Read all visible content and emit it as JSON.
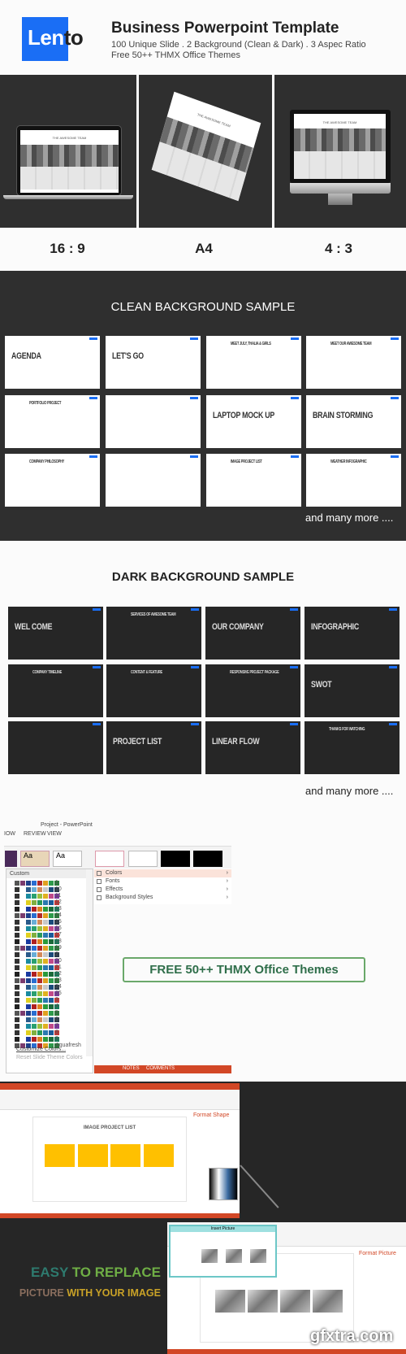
{
  "header": {
    "logo_text_a": "Len",
    "logo_text_b": "to",
    "title": "Business Powerpoint Template",
    "subtitle_1": "100 Unique Slide . 2 Background (Clean & Dark) . 3 Aspec Ratio",
    "subtitle_2": "Free 50++ THMX Office Themes"
  },
  "devices": [
    {
      "label": "16 : 9",
      "device": "laptop",
      "slide_title": "THE AWESOME TEAM"
    },
    {
      "label": "A4",
      "device": "paper",
      "slide_title": "THE AWESOME TEAM"
    },
    {
      "label": "4 : 3",
      "device": "monitor",
      "slide_title": "THE AWESOME TEAM"
    }
  ],
  "clean": {
    "title": "CLEAN BACKGROUND SAMPLE",
    "slides": [
      {
        "title": "AGENDA"
      },
      {
        "title": "LET'S GO"
      },
      {
        "title": "MEET JULY, THALIA & GIRLS"
      },
      {
        "title": "MEET OUR AWESOME TEAM"
      },
      {
        "title": "PORTFOLIO PROJECT"
      },
      {
        "title": ""
      },
      {
        "title": "LAPTOP MOCK UP"
      },
      {
        "title": "BRAIN STORMING"
      },
      {
        "title": "COMPANY PHILOSOPHY"
      },
      {
        "title": ""
      },
      {
        "title": "IMAGE PROJECT LIST"
      },
      {
        "title": "WEATHER INFOGRAPHIC"
      }
    ],
    "more": "and many more ...."
  },
  "dark": {
    "title": "DARK BACKGROUND SAMPLE",
    "slides": [
      {
        "title": "WEL COME"
      },
      {
        "title": "SERVICES OF AWESOME TEAM"
      },
      {
        "title": "OUR COMPANY"
      },
      {
        "title": "INFOGRAPHIC"
      },
      {
        "title": "COMPANY TIMELINE"
      },
      {
        "title": "CONTENT & FEATURE"
      },
      {
        "title": "RESPONSIVE PROJECT PACKAGE"
      },
      {
        "title": "SWOT"
      },
      {
        "title": ""
      },
      {
        "title": "PROJECT LIST"
      },
      {
        "title": "LINEAR FLOW"
      },
      {
        "title": "THANKS FOR WATCHING"
      }
    ],
    "more": "and many more ...."
  },
  "powerpoint": {
    "window_title": "Project - PowerPoint",
    "tabs": [
      "IOW",
      "REVIEW",
      "VIEW"
    ],
    "list_header": "Custom",
    "themes": [
      "1",
      "10",
      "11",
      "12",
      "13",
      "14",
      "15",
      "16",
      "17",
      "18",
      "19",
      "2",
      "20",
      "21",
      "22",
      "23",
      "24",
      "25",
      "3",
      "4",
      "5",
      "6",
      "7",
      "8",
      "9",
      "Aquafresh"
    ],
    "palettes": [
      [
        "#555",
        "#7a3b6e",
        "#1f3f8a",
        "#2a6dd0",
        "#b22a2a",
        "#e0a020",
        "#2d9a4a",
        "#2a7a3a"
      ],
      [
        "#333",
        "#fff",
        "#2a5a8a",
        "#6aaed6",
        "#d48a5a",
        "#c8c8c8",
        "#1a4a7a",
        "#2a3a4a"
      ],
      [
        "#333",
        "#fff",
        "#1a8aa0",
        "#2aa070",
        "#9ac040",
        "#e0b020",
        "#c04a8a",
        "#7a3a9a"
      ],
      [
        "#333",
        "#fff",
        "#e0d020",
        "#80b040",
        "#2a9a5a",
        "#2a7ab0",
        "#1a5a9a",
        "#c03a3a"
      ],
      [
        "#222",
        "#fff",
        "#1a3aa0",
        "#b02020",
        "#e08020",
        "#2a9a3a",
        "#1a6a3a",
        "#1a7a5a"
      ]
    ],
    "menu": [
      {
        "label": "Colors",
        "icon": "colors-icon"
      },
      {
        "label": "Fonts",
        "icon": "fonts-icon"
      },
      {
        "label": "Effects",
        "icon": "effects-icon"
      },
      {
        "label": "Background Styles",
        "icon": "background-styles-icon"
      }
    ],
    "footer_links": [
      "Customize Colors...",
      "Reset Slide Theme Colors"
    ],
    "status": {
      "notes": "NOTES",
      "comments": "COMMENTS"
    },
    "promo": "FREE 50++ THMX Office Themes"
  },
  "replace": {
    "slide_title": "IMAGE PROJECT LIST",
    "panel_1": "Format Shape",
    "panel_2": "Format Picture",
    "dialog_title": "Insert Picture",
    "headline_a": "EASY",
    "headline_b": "TO REPLACE",
    "line2_a": "PICTURE",
    "line2_b": "WITH YOUR IMAGE",
    "colors": {
      "easy": "#2e7a6e",
      "to_replace": "#6fae45",
      "picture": "#8a6e5e",
      "with_your_image": "#c9a227",
      "ribbon": "#d24726",
      "placeholder": "#ffc000"
    }
  },
  "watermark": "gfxtra.com",
  "colors": {
    "brand_blue": "#1a6ef5",
    "panel_dark": "#2f2f2f"
  }
}
